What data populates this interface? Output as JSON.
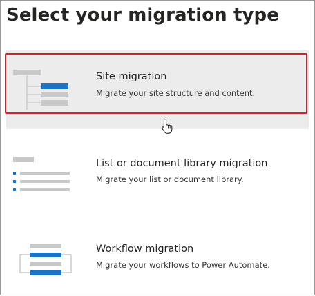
{
  "page": {
    "title": "Select your migration type"
  },
  "options": [
    {
      "name": "Site migration",
      "description": "Migrate your site structure and content.",
      "icon": "site-hierarchy-icon",
      "state": "hovered"
    },
    {
      "name": "List or document library migration",
      "description": "Migrate your list or document library.",
      "icon": "list-library-icon",
      "state": "default"
    },
    {
      "name": "Workflow migration",
      "description": "Migrate your workflows to Power Automate.",
      "icon": "workflow-icon",
      "state": "default"
    }
  ],
  "colors": {
    "accent_blue": "#1a73c9",
    "icon_gray": "#c8c8c8",
    "connector_gray": "#bdbdbd",
    "hover_bg": "#ececec",
    "highlight_red": "#d0212f"
  }
}
